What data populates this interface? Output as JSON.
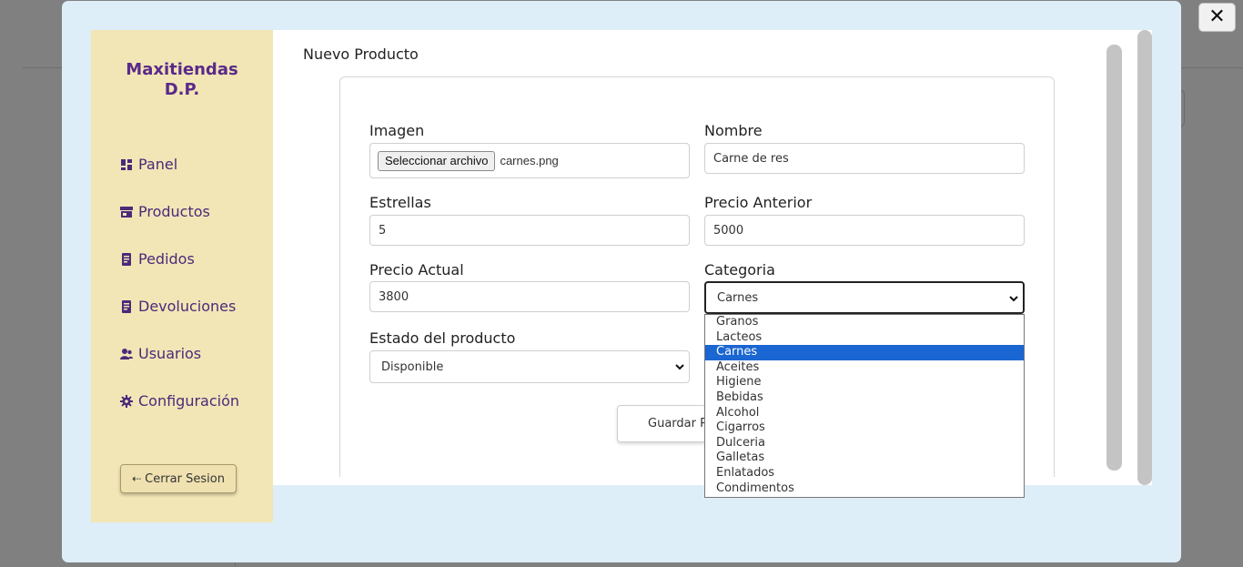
{
  "close_label": "✕",
  "brand": {
    "line1": "Maxitiendas",
    "line2": "D.P."
  },
  "nav": [
    {
      "label": "Panel",
      "icon": "dashboard-icon"
    },
    {
      "label": "Productos",
      "icon": "store-icon"
    },
    {
      "label": "Pedidos",
      "icon": "receipt-icon"
    },
    {
      "label": "Devoluciones",
      "icon": "receipt-icon"
    },
    {
      "label": "Usuarios",
      "icon": "users-icon"
    },
    {
      "label": "Configuración",
      "icon": "gear-icon"
    }
  ],
  "logout_label": "Cerrar Sesion",
  "page_title": "Nuevo Producto",
  "form": {
    "imagen": {
      "label": "Imagen",
      "button": "Seleccionar archivo",
      "file": "carnes.png"
    },
    "nombre": {
      "label": "Nombre",
      "value": "Carne de res"
    },
    "estrellas": {
      "label": "Estrellas",
      "value": "5"
    },
    "precio_anterior": {
      "label": "Precio Anterior",
      "value": "5000"
    },
    "precio_actual": {
      "label": "Precio Actual",
      "value": "3800"
    },
    "categoria": {
      "label": "Categoria",
      "value": "Carnes"
    },
    "estado": {
      "label": "Estado del producto",
      "value": "Disponible"
    },
    "save_label": "Guardar Producto"
  },
  "categoria_options": [
    "Granos",
    "Lacteos",
    "Carnes",
    "Aceites",
    "Higiene",
    "Bebidas",
    "Alcohol",
    "Cigarros",
    "Dulceria",
    "Galletas",
    "Enlatados",
    "Condimentos"
  ],
  "categoria_selected_index": 2,
  "colors": {
    "brand": "#5a2a8a",
    "sidebar": "#f2e6b6",
    "modal": "#deeef8",
    "highlight": "#1a66d2"
  }
}
